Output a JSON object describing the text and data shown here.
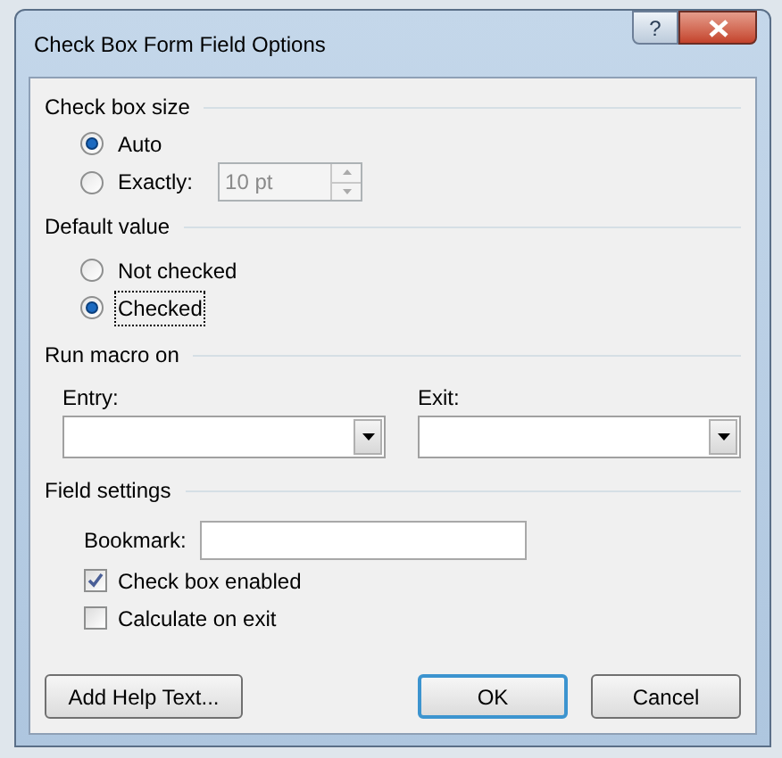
{
  "window": {
    "title": "Check Box Form Field Options",
    "help_button": "?"
  },
  "check_box_size": {
    "heading": "Check box size",
    "options": [
      {
        "label": "Auto",
        "selected": true
      },
      {
        "label": "Exactly:",
        "selected": false
      }
    ],
    "size_field": {
      "value": "10 pt",
      "disabled": true
    }
  },
  "default_value": {
    "heading": "Default value",
    "options": [
      {
        "label": "Not checked",
        "selected": false
      },
      {
        "label": "Checked",
        "selected": true
      }
    ]
  },
  "run_macro_on": {
    "heading": "Run macro on",
    "dropdowns": [
      {
        "label": "Entry:"
      },
      {
        "label": "Exit:"
      }
    ]
  },
  "field_settings": {
    "heading": "Field settings",
    "bookmark_label": "Bookmark:",
    "checkboxes": [
      {
        "label": "Check box enabled",
        "checked": true
      },
      {
        "label": "Calculate on exit",
        "checked": false
      }
    ]
  },
  "buttons": [
    {
      "label": "Add Help Text...",
      "default": false
    },
    {
      "label": "OK",
      "default": true
    },
    {
      "label": "Cancel",
      "default": false
    }
  ]
}
